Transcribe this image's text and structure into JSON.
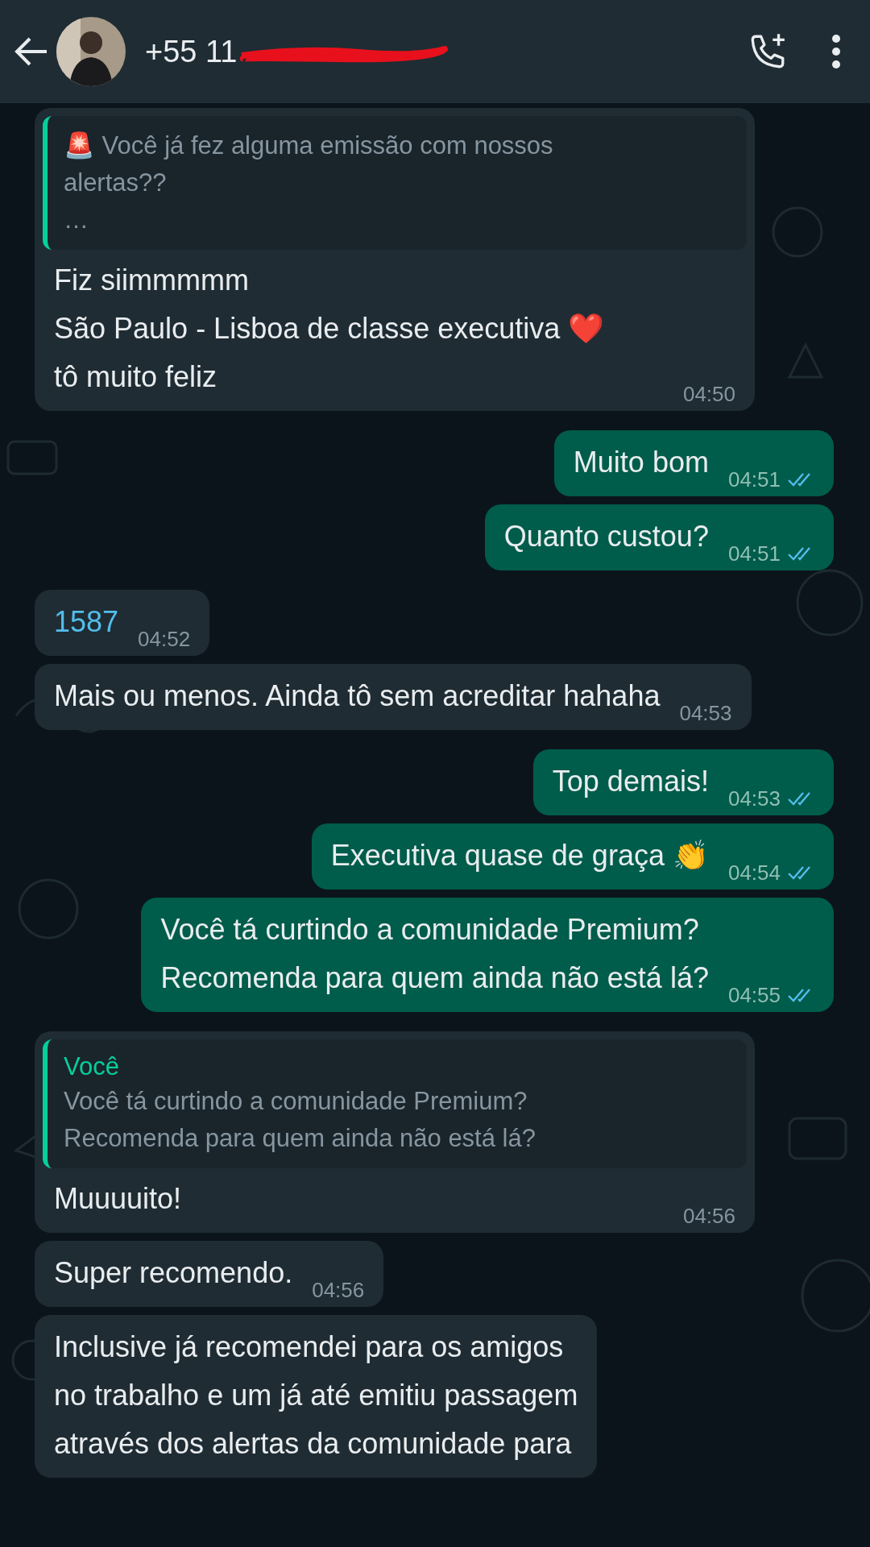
{
  "header": {
    "contact": "+55 11",
    "redacted": true
  },
  "messages": [
    {
      "kind": "incoming",
      "quote": {
        "text": "🚨 Você já fez alguma emissão com nossos\nalertas??\n…"
      },
      "text": "Fiz siimmmmm\nSão Paulo - Lisboa de classe executiva ❤️\ntô muito feliz",
      "time": "04:50"
    },
    {
      "kind": "outgoing",
      "text": "Muito bom",
      "time": "04:51",
      "read": true
    },
    {
      "kind": "outgoing",
      "text": "Quanto custou?",
      "time": "04:51",
      "read": true
    },
    {
      "kind": "incoming",
      "text": "1587",
      "link": true,
      "time": "04:52"
    },
    {
      "kind": "incoming",
      "text": "Mais ou menos. Ainda tô sem acreditar hahaha",
      "time": "04:53"
    },
    {
      "kind": "outgoing",
      "text": "Top demais!",
      "time": "04:53",
      "read": true
    },
    {
      "kind": "outgoing",
      "text": "Executiva quase de graça 👏",
      "time": "04:54",
      "read": true
    },
    {
      "kind": "outgoing",
      "text": "Você tá curtindo a comunidade Premium?\nRecomenda para quem ainda não está lá?",
      "time": "04:55",
      "read": true
    },
    {
      "kind": "incoming",
      "quote": {
        "sender": "Você",
        "text": "Você tá curtindo a comunidade Premium?\nRecomenda para quem ainda não está lá?"
      },
      "text": "Muuuuito!",
      "time": "04:56"
    },
    {
      "kind": "incoming",
      "text": "Super recomendo.",
      "time": "04:56"
    },
    {
      "kind": "incoming",
      "text": "Inclusive já recomendei para os amigos\nno trabalho e um já até emitiu passagem\natravés dos alertas da comunidade para"
    }
  ]
}
